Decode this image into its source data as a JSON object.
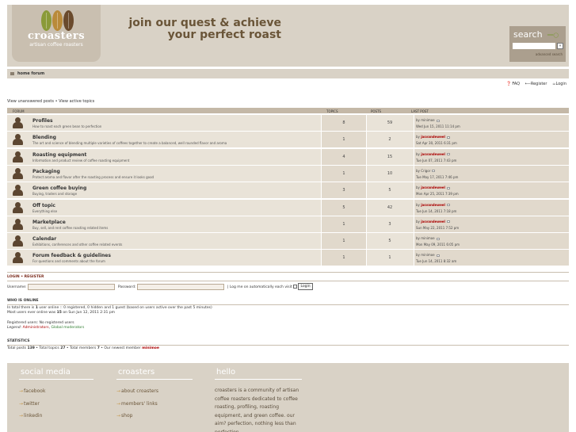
{
  "brand": {
    "name": "croasters",
    "subtitle": "artisan coffee roasters",
    "tagline_line1": "join our quest & achieve",
    "tagline_line2": "your perfect roast",
    "bean_colors": [
      "#8a9a38",
      "#b98a3a",
      "#6a4a2c"
    ]
  },
  "search": {
    "title": "search",
    "advanced_label": "advanced search",
    "go_label": "»"
  },
  "nav": {
    "home_label": "home forum"
  },
  "toplinks": {
    "faq": "FAQ",
    "register": "Register",
    "login": "Login"
  },
  "viewlinks": "View unanswered posts • View active topics",
  "table_headers": {
    "forum": "FORUM",
    "topics": "TOPICS",
    "posts": "POSTS",
    "last_post": "LAST POST"
  },
  "forums": [
    {
      "title": "Profiles",
      "desc": "How to roast each green bean to perfection",
      "topics": "8",
      "posts": "59",
      "last_by": "minimoe",
      "last_by_highlight": false,
      "last_date": "Wed Jun 15, 2011 11:14 pm"
    },
    {
      "title": "Blending",
      "desc": "The art and science of blending multiple varieties of coffees together to create a balanced, well rounded flavor and aroma",
      "topics": "1",
      "posts": "2",
      "last_by": "jasvandeweel",
      "last_by_highlight": true,
      "last_date": "Sat Apr 30, 2011 6:31 pm"
    },
    {
      "title": "Roasting equipment",
      "desc": "Information and product review of coffee roasting equipment",
      "topics": "4",
      "posts": "15",
      "last_by": "jasvandeweel",
      "last_by_highlight": true,
      "last_date": "Tue Jun 07, 2011 7:43 pm"
    },
    {
      "title": "Packaging",
      "desc": "Protect aroma and flavor after the roasting process and ensure it looks good",
      "topics": "1",
      "posts": "10",
      "last_by": "Crigor",
      "last_by_highlight": false,
      "last_date": "Tue May 17, 2011 7:46 pm"
    },
    {
      "title": "Green coffee buying",
      "desc": "Buying, traders and storage",
      "topics": "3",
      "posts": "5",
      "last_by": "jasvandeweel",
      "last_by_highlight": true,
      "last_date": "Mon Apr 25, 2011 7:39 pm"
    },
    {
      "title": "Off topic",
      "desc": "Everything else",
      "topics": "5",
      "posts": "42",
      "last_by": "jasvandeweel",
      "last_by_highlight": true,
      "last_date": "Tue Jun 14, 2011 7:18 pm"
    },
    {
      "title": "Marketplace",
      "desc": "Buy, sell, and rent coffee roasting related items",
      "topics": "1",
      "posts": "3",
      "last_by": "jasvandeweel",
      "last_by_highlight": true,
      "last_date": "Sun May 22, 2011 7:52 pm"
    },
    {
      "title": "Calendar",
      "desc": "Exhibitions, conferences and other coffee related events",
      "topics": "1",
      "posts": "5",
      "last_by": "minimoe",
      "last_by_highlight": false,
      "last_date": "Mon May 09, 2011 6:05 pm"
    },
    {
      "title": "Forum feedback & guidelines",
      "desc": "For questions and comments about the forum",
      "topics": "1",
      "posts": "1",
      "last_by": "minimoe",
      "last_by_highlight": false,
      "last_date": "Tue Jun 14, 2011 8:32 am"
    }
  ],
  "by_label": "by",
  "login": {
    "title": "LOGIN • REGISTER",
    "username_label": "Username:",
    "password_label": "Password:",
    "remember_label": "| Log me on automatically each visit",
    "button": "Login"
  },
  "who": {
    "title": "WHO IS ONLINE",
    "line1_pre": "In total there is ",
    "line1_count": "1",
    "line1_post": " user online :: 0 registered, 0 hidden and 1 guest (based on users active over the past 5 minutes)",
    "line2_pre": "Most users ever online was ",
    "line2_count": "15",
    "line2_post": " on Sun Jun 12, 2011 2:31 pm",
    "registered": "Registered users: No registered users",
    "legend_label": "Legend:",
    "legend_admin": "Administrators",
    "legend_sep": ",",
    "legend_mod": "Global moderators"
  },
  "stats": {
    "title": "STATISTICS",
    "pre": "Total posts ",
    "posts": "139",
    "mid1": " • Total topics ",
    "topics": "27",
    "mid2": " • Total members ",
    "members": "7",
    "mid3": " • Our newest member ",
    "newest": "minimoe"
  },
  "footer": {
    "col1_title": "social media",
    "col1_links": [
      "facebook",
      "twitter",
      "linkedin"
    ],
    "col2_title": "croasters",
    "col2_links": [
      "about croasters",
      "members' links",
      "shop"
    ],
    "col3_title": "hello",
    "hello_text": "croasters is a community of artisan coffee roasters dedicated to coffee roasting, profiling, roasting equipment, and green coffee. our aim? perfection, nothing less than perfection.",
    "arrow": "→"
  },
  "colors": {
    "header_bg": "#d9d2c6",
    "accent": "#6a5538",
    "link_red": "#aa0000"
  }
}
